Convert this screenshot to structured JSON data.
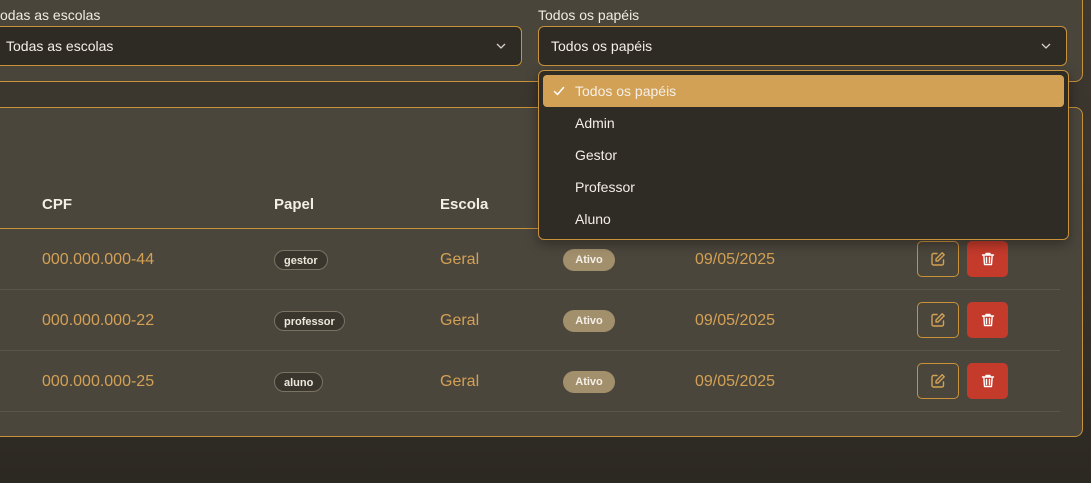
{
  "filters": {
    "school": {
      "label": "odas as escolas",
      "value": "Todas as escolas"
    },
    "role": {
      "label": "Todos os papéis",
      "value": "Todos os papéis"
    }
  },
  "role_dropdown": {
    "options": [
      "Todos os papéis",
      "Admin",
      "Gestor",
      "Professor",
      "Aluno"
    ],
    "selected": "Todos os papéis"
  },
  "table": {
    "headers": {
      "cpf": "CPF",
      "papel": "Papel",
      "escola": "Escola"
    },
    "rows": [
      {
        "cpf": "000.000.000-44",
        "papel": "gestor",
        "escola": "Geral",
        "status": "Ativo",
        "date": "09/05/2025"
      },
      {
        "cpf": "000.000.000-22",
        "papel": "professor",
        "escola": "Geral",
        "status": "Ativo",
        "date": "09/05/2025"
      },
      {
        "cpf": "000.000.000-25",
        "papel": "aluno",
        "escola": "Geral",
        "status": "Ativo",
        "date": "09/05/2025"
      }
    ]
  },
  "colors": {
    "accent": "#c8913a",
    "gold_text": "#d3a155",
    "delete": "#c43a2b",
    "status_badge": "#a28f6c"
  },
  "icons": {
    "select_arrow": "chevron-down-icon",
    "selected_option": "check-icon",
    "edit": "edit-icon",
    "delete": "trash-icon"
  }
}
